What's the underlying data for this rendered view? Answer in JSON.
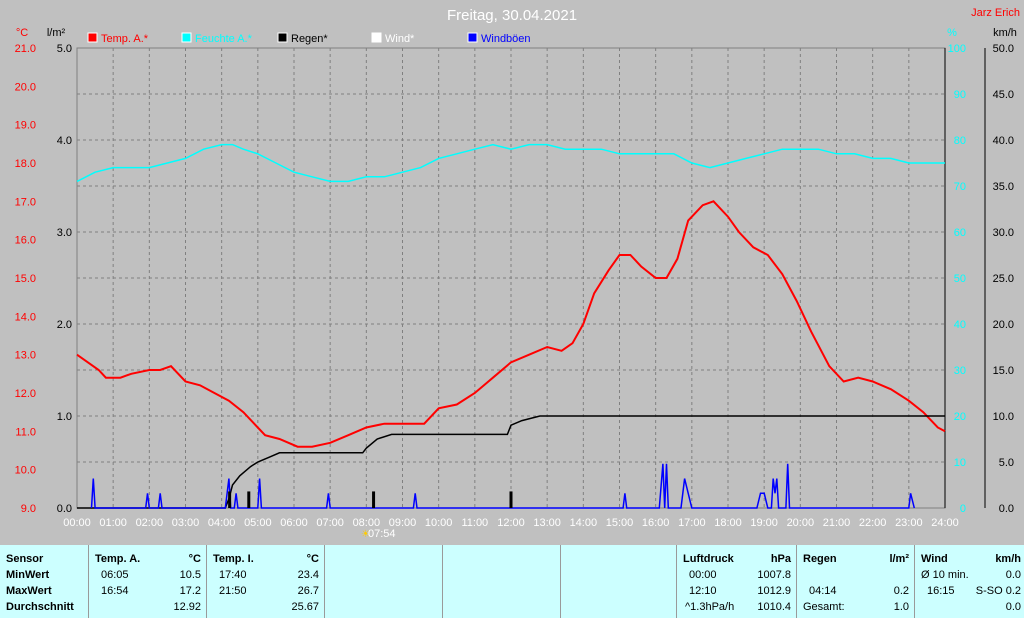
{
  "window": {
    "author": "Jarz Erich"
  },
  "chart_data": {
    "type": "line",
    "title": "Freitag, 30.04.2021",
    "axes": {
      "temp_unit": "°C",
      "temp_range": [
        9.0,
        21.0
      ],
      "temp_ticks": [
        "21.0",
        "20.0",
        "19.0",
        "18.0",
        "17.0",
        "16.0",
        "15.0",
        "14.0",
        "13.0",
        "12.0",
        "11.0",
        "10.0",
        "9.0"
      ],
      "rain_unit": "l/m²",
      "rain_range": [
        0,
        5
      ],
      "rain_ticks": [
        "5.0",
        "4.0",
        "3.0",
        "2.0",
        "1.0",
        "0.0"
      ],
      "humidity_unit": "%",
      "humidity_range": [
        0,
        100
      ],
      "humidity_ticks": [
        "100",
        "90",
        "80",
        "70",
        "60",
        "50",
        "40",
        "30",
        "20",
        "10",
        "0"
      ],
      "wind_unit": "km/h",
      "wind_range": [
        0,
        50
      ],
      "wind_ticks": [
        "50.0",
        "45.0",
        "40.0",
        "35.0",
        "30.0",
        "25.0",
        "20.0",
        "15.0",
        "10.0",
        "5.0",
        "0.0"
      ],
      "x_ticks": [
        "00:00",
        "01:00",
        "02:00",
        "03:00",
        "04:00",
        "05:00",
        "06:00",
        "07:00",
        "08:00",
        "09:00",
        "10:00",
        "11:00",
        "12:00",
        "13:00",
        "14:00",
        "15:00",
        "16:00",
        "17:00",
        "18:00",
        "19:00",
        "20:00",
        "21:00",
        "22:00",
        "23:00",
        "24:00"
      ],
      "grid": true
    },
    "sunrise_label": "07:54",
    "legend_position": "top-left",
    "legend": [
      {
        "label": "Temp. A.*",
        "color": "#ff0000"
      },
      {
        "label": "Feuchte A.*",
        "color": "#00ffff"
      },
      {
        "label": "Regen*",
        "color": "#000000"
      },
      {
        "label": "Wind*",
        "color": "#ffffff"
      },
      {
        "label": "Windböen",
        "color": "#0000ff"
      }
    ],
    "series": [
      {
        "name": "Temp. A.*",
        "color": "#ff0000",
        "axis": "temp",
        "points": [
          [
            0,
            13.0
          ],
          [
            0.3,
            12.8
          ],
          [
            0.6,
            12.6
          ],
          [
            0.8,
            12.4
          ],
          [
            1.2,
            12.4
          ],
          [
            1.5,
            12.5
          ],
          [
            2.0,
            12.6
          ],
          [
            2.3,
            12.6
          ],
          [
            2.6,
            12.7
          ],
          [
            3.0,
            12.3
          ],
          [
            3.4,
            12.2
          ],
          [
            3.8,
            12.0
          ],
          [
            4.2,
            11.8
          ],
          [
            4.6,
            11.5
          ],
          [
            4.9,
            11.2
          ],
          [
            5.2,
            10.9
          ],
          [
            5.6,
            10.8
          ],
          [
            6.1,
            10.6
          ],
          [
            6.5,
            10.6
          ],
          [
            7.0,
            10.7
          ],
          [
            7.5,
            10.9
          ],
          [
            8.0,
            11.1
          ],
          [
            8.5,
            11.2
          ],
          [
            9.2,
            11.2
          ],
          [
            9.6,
            11.2
          ],
          [
            10.0,
            11.6
          ],
          [
            10.5,
            11.7
          ],
          [
            11.0,
            12.0
          ],
          [
            11.5,
            12.4
          ],
          [
            12.0,
            12.8
          ],
          [
            12.5,
            13.0
          ],
          [
            13.0,
            13.2
          ],
          [
            13.4,
            13.1
          ],
          [
            13.7,
            13.3
          ],
          [
            14.0,
            13.8
          ],
          [
            14.3,
            14.6
          ],
          [
            14.7,
            15.2
          ],
          [
            15.0,
            15.6
          ],
          [
            15.3,
            15.6
          ],
          [
            15.6,
            15.3
          ],
          [
            16.0,
            15.0
          ],
          [
            16.3,
            15.0
          ],
          [
            16.6,
            15.5
          ],
          [
            16.9,
            16.5
          ],
          [
            17.3,
            16.9
          ],
          [
            17.6,
            17.0
          ],
          [
            18.0,
            16.6
          ],
          [
            18.3,
            16.2
          ],
          [
            18.7,
            15.8
          ],
          [
            19.1,
            15.6
          ],
          [
            19.5,
            15.1
          ],
          [
            19.9,
            14.4
          ],
          [
            20.3,
            13.6
          ],
          [
            20.8,
            12.7
          ],
          [
            21.2,
            12.3
          ],
          [
            21.6,
            12.4
          ],
          [
            22.0,
            12.3
          ],
          [
            22.5,
            12.1
          ],
          [
            23.0,
            11.8
          ],
          [
            23.4,
            11.5
          ],
          [
            23.8,
            11.1
          ],
          [
            24.0,
            11.0
          ]
        ]
      },
      {
        "name": "Feuchte A.*",
        "color": "#00ffff",
        "axis": "humidity",
        "points": [
          [
            0,
            71
          ],
          [
            0.5,
            73
          ],
          [
            1.0,
            74
          ],
          [
            1.5,
            74
          ],
          [
            2.0,
            74
          ],
          [
            2.5,
            75
          ],
          [
            3.0,
            76
          ],
          [
            3.5,
            78
          ],
          [
            4.0,
            79
          ],
          [
            4.3,
            79
          ],
          [
            4.6,
            78
          ],
          [
            5.0,
            77
          ],
          [
            5.5,
            75
          ],
          [
            6.0,
            73
          ],
          [
            6.5,
            72
          ],
          [
            7.0,
            71
          ],
          [
            7.5,
            71
          ],
          [
            8.0,
            72
          ],
          [
            8.5,
            72
          ],
          [
            9.0,
            73
          ],
          [
            9.5,
            74
          ],
          [
            10.0,
            76
          ],
          [
            10.5,
            77
          ],
          [
            11.0,
            78
          ],
          [
            11.5,
            79
          ],
          [
            12.0,
            78
          ],
          [
            12.5,
            79
          ],
          [
            13.0,
            79
          ],
          [
            13.5,
            78
          ],
          [
            14.0,
            78
          ],
          [
            14.5,
            78
          ],
          [
            15.0,
            77
          ],
          [
            15.5,
            77
          ],
          [
            16.0,
            77
          ],
          [
            16.5,
            77
          ],
          [
            17.0,
            75
          ],
          [
            17.5,
            74
          ],
          [
            18.0,
            75
          ],
          [
            18.5,
            76
          ],
          [
            19.0,
            77
          ],
          [
            19.5,
            78
          ],
          [
            20.0,
            78
          ],
          [
            20.5,
            78
          ],
          [
            21.0,
            77
          ],
          [
            21.5,
            77
          ],
          [
            22.0,
            76
          ],
          [
            22.5,
            76
          ],
          [
            23.0,
            75
          ],
          [
            23.5,
            75
          ],
          [
            24.0,
            75
          ]
        ]
      },
      {
        "name": "Regen*",
        "color": "#000000",
        "axis": "rain",
        "points": [
          [
            0,
            0
          ],
          [
            4.1,
            0
          ],
          [
            4.2,
            0.1
          ],
          [
            4.3,
            0.25
          ],
          [
            4.5,
            0.35
          ],
          [
            4.8,
            0.45
          ],
          [
            5.0,
            0.5
          ],
          [
            5.3,
            0.55
          ],
          [
            5.6,
            0.6
          ],
          [
            7.0,
            0.6
          ],
          [
            7.9,
            0.6
          ],
          [
            8.0,
            0.65
          ],
          [
            8.3,
            0.75
          ],
          [
            8.7,
            0.8
          ],
          [
            9.3,
            0.8
          ],
          [
            9.5,
            0.8
          ],
          [
            10.0,
            0.8
          ],
          [
            11.9,
            0.8
          ],
          [
            12.0,
            0.9
          ],
          [
            12.3,
            0.95
          ],
          [
            12.8,
            1.0
          ],
          [
            24.0,
            1.0
          ]
        ]
      },
      {
        "name": "Windböen",
        "color": "#0000ff",
        "axis": "wind",
        "points": [
          [
            0.4,
            0
          ],
          [
            0.45,
            3.2
          ],
          [
            0.5,
            0
          ],
          [
            1.9,
            0
          ],
          [
            1.95,
            1.6
          ],
          [
            2.0,
            0
          ],
          [
            2.25,
            0
          ],
          [
            2.3,
            1.6
          ],
          [
            2.35,
            0
          ],
          [
            4.1,
            0
          ],
          [
            4.15,
            1.6
          ],
          [
            4.2,
            3.2
          ],
          [
            4.25,
            0
          ],
          [
            4.35,
            0
          ],
          [
            4.4,
            1.6
          ],
          [
            4.45,
            0
          ],
          [
            5.0,
            0
          ],
          [
            5.05,
            3.2
          ],
          [
            5.1,
            0
          ],
          [
            6.9,
            0
          ],
          [
            6.95,
            1.6
          ],
          [
            7.0,
            0
          ],
          [
            9.3,
            0
          ],
          [
            9.35,
            1.6
          ],
          [
            9.4,
            0
          ],
          [
            15.1,
            0
          ],
          [
            15.15,
            1.6
          ],
          [
            15.2,
            0
          ],
          [
            16.1,
            0
          ],
          [
            16.2,
            4.8
          ],
          [
            16.25,
            0
          ],
          [
            16.3,
            4.8
          ],
          [
            16.35,
            0
          ],
          [
            16.7,
            0
          ],
          [
            16.8,
            3.2
          ],
          [
            16.9,
            1.6
          ],
          [
            17.0,
            0
          ],
          [
            18.8,
            0
          ],
          [
            18.9,
            1.6
          ],
          [
            19.0,
            1.6
          ],
          [
            19.1,
            0
          ],
          [
            19.2,
            0
          ],
          [
            19.25,
            3.2
          ],
          [
            19.3,
            1.6
          ],
          [
            19.35,
            3.2
          ],
          [
            19.4,
            0
          ],
          [
            19.6,
            0
          ],
          [
            19.65,
            4.8
          ],
          [
            19.7,
            0
          ],
          [
            23.0,
            0
          ],
          [
            23.05,
            1.6
          ],
          [
            23.15,
            0
          ]
        ]
      }
    ],
    "rain_bars": [
      [
        4.22,
        0.18
      ],
      [
        4.75,
        0.18
      ],
      [
        8.2,
        0.18
      ],
      [
        12.0,
        0.18
      ]
    ]
  },
  "footer": {
    "sensor": {
      "header": "Sensor",
      "rows": [
        "MinWert",
        "MaxWert",
        "Durchschnitt"
      ]
    },
    "temp_a": {
      "header": "Temp. A.",
      "unit": "°C",
      "min_time": "06:05",
      "min_val": "10.5",
      "max_time": "16:54",
      "max_val": "17.2",
      "avg_val": "12.92"
    },
    "temp_i": {
      "header": "Temp. I.",
      "unit": "°C",
      "min_time": "17:40",
      "min_val": "23.4",
      "max_time": "21:50",
      "max_val": "26.7",
      "avg_val": "25.67"
    },
    "pressure": {
      "header": "Luftdruck",
      "unit": "hPa",
      "min_time": "00:00",
      "min_val": "1007.8",
      "max_time": "12:10",
      "max_val": "1012.9",
      "avg_label": "^1.3hPa/h",
      "avg_val": "1010.4"
    },
    "rain": {
      "header": "Regen",
      "unit": "l/m²",
      "max_time": "04:14",
      "max_val": "0.2",
      "total_label": "Gesamt:",
      "total_val": "1.0"
    },
    "wind": {
      "header": "Wind",
      "unit": "km/h",
      "min_label": "Ø 10 min.",
      "min_val": "0.0",
      "max_time": "16:15",
      "max_val": "S-SO 0.2",
      "avg_val": "0.0"
    }
  }
}
